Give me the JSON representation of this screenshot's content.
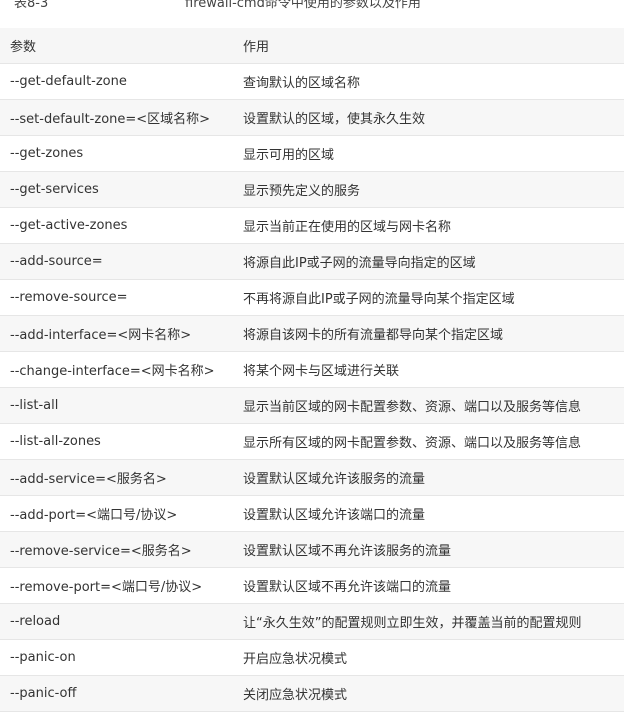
{
  "caption": {
    "number": "表8-3",
    "title": "firewall-cmd命令中使用的参数以及作用"
  },
  "table": {
    "headers": [
      "参数",
      "作用"
    ],
    "rows": [
      [
        "--get-default-zone",
        "查询默认的区域名称"
      ],
      [
        "--set-default-zone=<区域名称>",
        "设置默认的区域，使其永久生效"
      ],
      [
        "--get-zones",
        "显示可用的区域"
      ],
      [
        "--get-services",
        "显示预先定义的服务"
      ],
      [
        "--get-active-zones",
        "显示当前正在使用的区域与网卡名称"
      ],
      [
        "--add-source=",
        "将源自此IP或子网的流量导向指定的区域"
      ],
      [
        "--remove-source=",
        "不再将源自此IP或子网的流量导向某个指定区域"
      ],
      [
        "--add-interface=<网卡名称>",
        "将源自该网卡的所有流量都导向某个指定区域"
      ],
      [
        "--change-interface=<网卡名称>",
        "将某个网卡与区域进行关联"
      ],
      [
        "--list-all",
        "显示当前区域的网卡配置参数、资源、端口以及服务等信息"
      ],
      [
        "--list-all-zones",
        "显示所有区域的网卡配置参数、资源、端口以及服务等信息"
      ],
      [
        "--add-service=<服务名>",
        "设置默认区域允许该服务的流量"
      ],
      [
        "--add-port=<端口号/协议>",
        "设置默认区域允许该端口的流量"
      ],
      [
        "--remove-service=<服务名>",
        "设置默认区域不再允许该服务的流量"
      ],
      [
        "--remove-port=<端口号/协议>",
        "设置默认区域不再允许该端口的流量"
      ],
      [
        "--reload",
        "让“永久生效”的配置规则立即生效，并覆盖当前的配置规则"
      ],
      [
        "--panic-on",
        "开启应急状况模式"
      ],
      [
        "--panic-off",
        "关闭应急状况模式"
      ]
    ]
  }
}
